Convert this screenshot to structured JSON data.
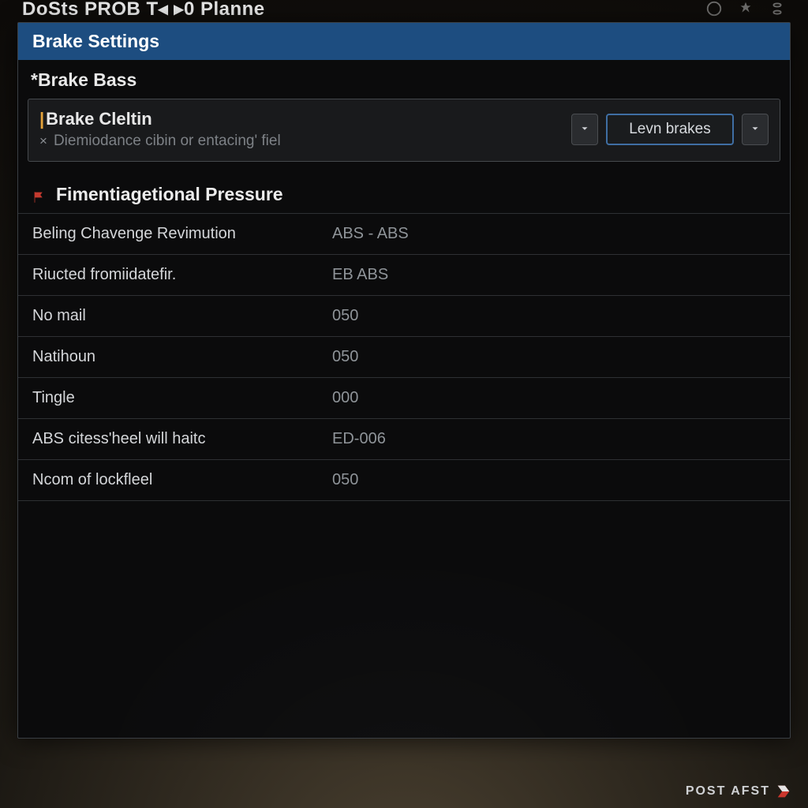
{
  "appbar": {
    "title": "DoSts  PROB  T◂  ▸0  Planne"
  },
  "panel": {
    "title": "Brake Settings",
    "subheader": "*Brake Bass",
    "selector": {
      "title_prefix": "|",
      "title": "Brake Cleltin",
      "desc_prefix": "×",
      "desc": "Diemiodance cibin or entacing' fiel",
      "value": "Levn brakes"
    },
    "section": {
      "title": "Fimentiagetional Pressure",
      "rows": [
        {
          "label": "Beling Chavenge Revimution",
          "value": "ABS - ABS"
        },
        {
          "label": "Riucted fromiidatefir.",
          "value": "EB ABS"
        },
        {
          "label": "No mail",
          "value": "050"
        },
        {
          "label": "Natihoun",
          "value": "050"
        },
        {
          "label": "Tingle",
          "value": "000"
        },
        {
          "label": "ABS citess'heel will haitc",
          "value": "ED-006"
        },
        {
          "label": "Ncom of lockfleel",
          "value": "050"
        }
      ]
    }
  },
  "brand": {
    "text": "POST AFST"
  }
}
